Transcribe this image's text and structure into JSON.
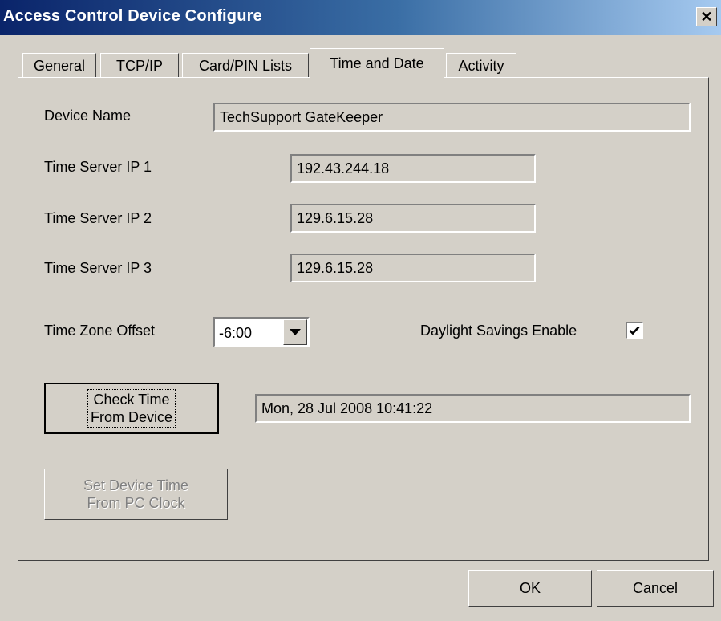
{
  "window": {
    "title": "Access Control Device Configure",
    "close_glyph": "✕"
  },
  "tabs": [
    {
      "label": "General",
      "active": false
    },
    {
      "label": "TCP/IP",
      "active": false
    },
    {
      "label": "Card/PIN Lists",
      "active": false
    },
    {
      "label": "Time and Date",
      "active": true
    },
    {
      "label": "Activity",
      "active": false
    }
  ],
  "form": {
    "device_name_label": "Device Name",
    "device_name_value": "TechSupport GateKeeper",
    "time_server_1_label": "Time Server IP 1",
    "time_server_1_value": "192.43.244.18",
    "time_server_2_label": "Time Server IP 2",
    "time_server_2_value": "129.6.15.28",
    "time_server_3_label": "Time Server IP 3",
    "time_server_3_value": "129.6.15.28",
    "timezone_label": "Time Zone Offset",
    "timezone_value": "-6:00",
    "dst_label": "Daylight Savings Enable",
    "dst_checked": true,
    "check_time_line1": "Check Time",
    "check_time_line2": "From Device",
    "device_time_value": "Mon, 28 Jul 2008 10:41:22",
    "set_time_line1": "Set Device Time",
    "set_time_line2": "From PC Clock"
  },
  "footer": {
    "ok_label": "OK",
    "cancel_label": "Cancel"
  },
  "colors": {
    "face": "#d4d0c8",
    "title_start": "#0a246a",
    "title_end": "#a6caf0",
    "disabled_text": "#808080"
  }
}
